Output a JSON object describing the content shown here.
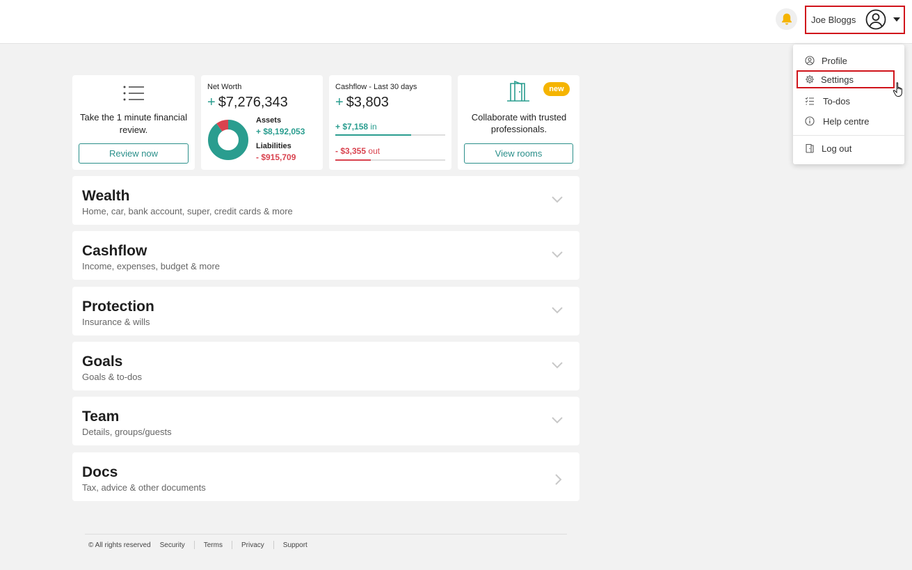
{
  "header": {
    "user_name": "Joe Bloggs"
  },
  "user_menu": {
    "items": [
      {
        "label": "Profile",
        "icon": "profile-icon"
      },
      {
        "label": "Settings",
        "icon": "gear-icon"
      },
      {
        "label": "To-dos",
        "icon": "checklist-icon"
      },
      {
        "label": "Help centre",
        "icon": "info-icon"
      },
      {
        "label": "Log out",
        "icon": "door-icon"
      }
    ]
  },
  "cards": {
    "review": {
      "text": "Take the 1 minute financial review.",
      "button": "Review now"
    },
    "net_worth": {
      "title": "Net Worth",
      "sign": "+",
      "value": "$7,276,343",
      "assets_label": "Assets",
      "assets_value": "+ $8,192,053",
      "liabilities_label": "Liabilities",
      "liabilities_value": "- $915,709",
      "asset_fraction": 0.9
    },
    "cashflow": {
      "title": "Cashflow - Last 30 days",
      "sign": "+",
      "value": "$3,803",
      "in_value": "+ $7,158",
      "in_label": "in",
      "out_value": "- $3,355",
      "out_label": "out",
      "in_fraction": 0.69,
      "out_fraction": 0.32
    },
    "rooms": {
      "badge": "new",
      "text": "Collaborate with trusted professionals.",
      "button": "View rooms"
    }
  },
  "sections": [
    {
      "title": "Wealth",
      "subtitle": "Home, car, bank account, super, credit cards & more",
      "icon": "chevron-down-icon"
    },
    {
      "title": "Cashflow",
      "subtitle": "Income, expenses, budget & more",
      "icon": "chevron-down-icon"
    },
    {
      "title": "Protection",
      "subtitle": "Insurance & wills",
      "icon": "chevron-down-icon"
    },
    {
      "title": "Goals",
      "subtitle": "Goals & to-dos",
      "icon": "chevron-down-icon"
    },
    {
      "title": "Team",
      "subtitle": "Details, groups/guests",
      "icon": "chevron-down-icon"
    },
    {
      "title": "Docs",
      "subtitle": "Tax, advice & other documents",
      "icon": "chevron-right-icon"
    }
  ],
  "footer": {
    "copyright": "© All rights reserved",
    "links": [
      "Security",
      "Terms",
      "Privacy",
      "Support"
    ]
  },
  "colors": {
    "accent": "#2a9d8f",
    "danger": "#d9434f",
    "highlight": "#d0141b",
    "badge": "#f5b400"
  }
}
